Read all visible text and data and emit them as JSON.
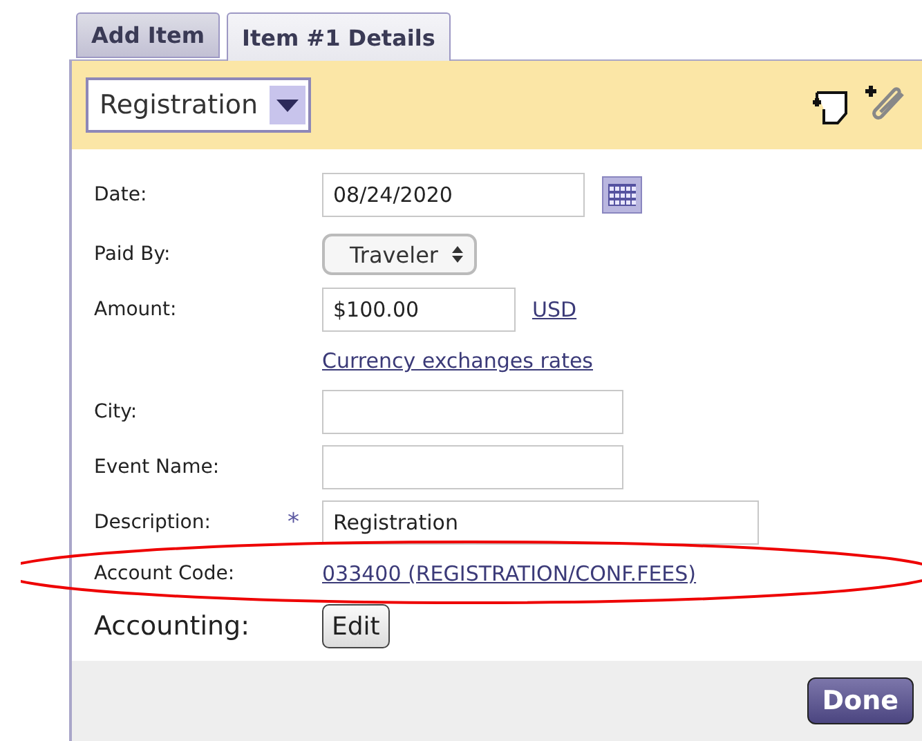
{
  "tabs": [
    {
      "label": "Add Item",
      "selected": false
    },
    {
      "label": "Item #1 Details",
      "selected": true
    }
  ],
  "header": {
    "expense_type": "Registration"
  },
  "fields": [
    {
      "kind": "date",
      "label": "Date:",
      "value": "08/24/2020"
    },
    {
      "kind": "select",
      "label": "Paid By:",
      "value": "Traveler"
    },
    {
      "kind": "amount",
      "label": "Amount:",
      "value": "$100.00",
      "currency": "USD"
    },
    {
      "kind": "link",
      "value": "Currency exchanges rates"
    },
    {
      "kind": "text",
      "label": "City:"
    },
    {
      "kind": "text",
      "label": "Event Name:"
    },
    {
      "kind": "text",
      "label": "Description:",
      "value": "Registration",
      "required_mark": "*"
    },
    {
      "kind": "link",
      "label": "Account Code:",
      "value": "033400 (REGISTRATION/CONF.FEES)"
    },
    {
      "kind": "button",
      "label": "Accounting:",
      "value": "Edit"
    }
  ],
  "footer": {
    "button": "Done"
  }
}
